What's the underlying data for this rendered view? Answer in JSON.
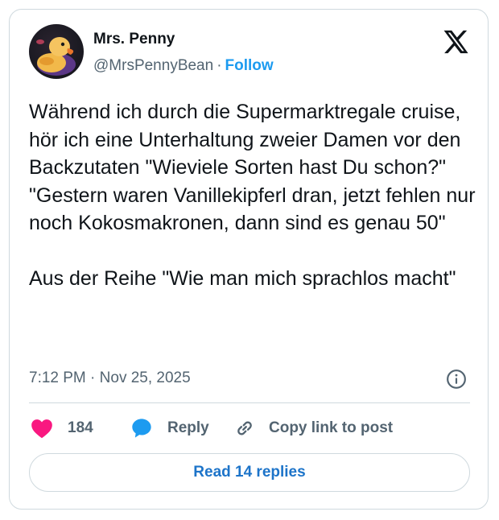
{
  "tweet": {
    "author_name": "Mrs. Penny",
    "handle": "@MrsPennyBean",
    "separator": "·",
    "follow_label": "Follow",
    "text": "Während ich durch die Supermarktregale cruise, hör ich eine Unterhaltung zweier Damen vor den Backzutaten \"Wieviele Sorten hast Du schon?\" \"Gestern waren Vanillekipferl dran, jetzt fehlen nur noch Kokosmakronen, dann sind es genau 50\"\n\nAus der Reihe \"Wie man mich sprachlos macht\"",
    "time": "7:12 PM",
    "date": "Nov 25, 2025",
    "meta_separator": "·"
  },
  "actions": {
    "like_count": "184",
    "reply_label": "Reply",
    "copy_label": "Copy link to post"
  },
  "footer": {
    "read_replies_label": "Read 14 replies"
  },
  "icons": {
    "avatar": "rubber-duck-avatar",
    "brand": "x-logo-icon",
    "info": "info-icon",
    "like": "heart-icon",
    "reply": "speech-bubble-icon",
    "copy": "link-icon"
  },
  "colors": {
    "like": "#f91880",
    "reply": "#1d9bf0",
    "follow": "#1d9bf0",
    "link_button": "#1d74c9",
    "muted": "#536471",
    "border": "#cfd9de"
  }
}
